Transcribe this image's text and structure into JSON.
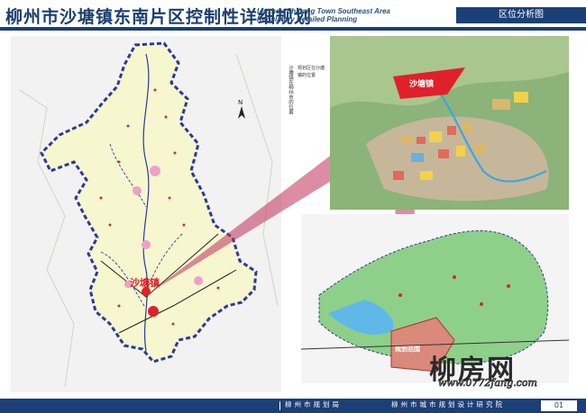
{
  "header": {
    "title_cn": "柳州市沙塘镇东南片区控制性详细规划",
    "title_en_line1": "Liuzhou Shatang Town Southeast Area",
    "title_en_line2": "Regulatory Detailed Planning",
    "section": "区位分析图"
  },
  "legend": {
    "label_1": "沙塘镇在柳州市的位置",
    "label_2": "规划区在沙塘镇的位置"
  },
  "main_map": {
    "marker_label": "沙塘镇",
    "compass": "N"
  },
  "inset_top": {
    "label": "沙塘镇"
  },
  "inset_bottom": {
    "label": "规划范围"
  },
  "watermark": {
    "logo": "柳房网",
    "url": "www.0772fang.com"
  },
  "footer": {
    "left": "柳州市规划局",
    "right": "柳州市城市规划设计研究院",
    "page": "01"
  },
  "colors": {
    "brand_blue": "#1b3f77",
    "map_fill": "#f6f6cf",
    "boundary": "#2a3a9a",
    "marker_red": "#e0202a",
    "pink_beam": "#c0305a"
  }
}
